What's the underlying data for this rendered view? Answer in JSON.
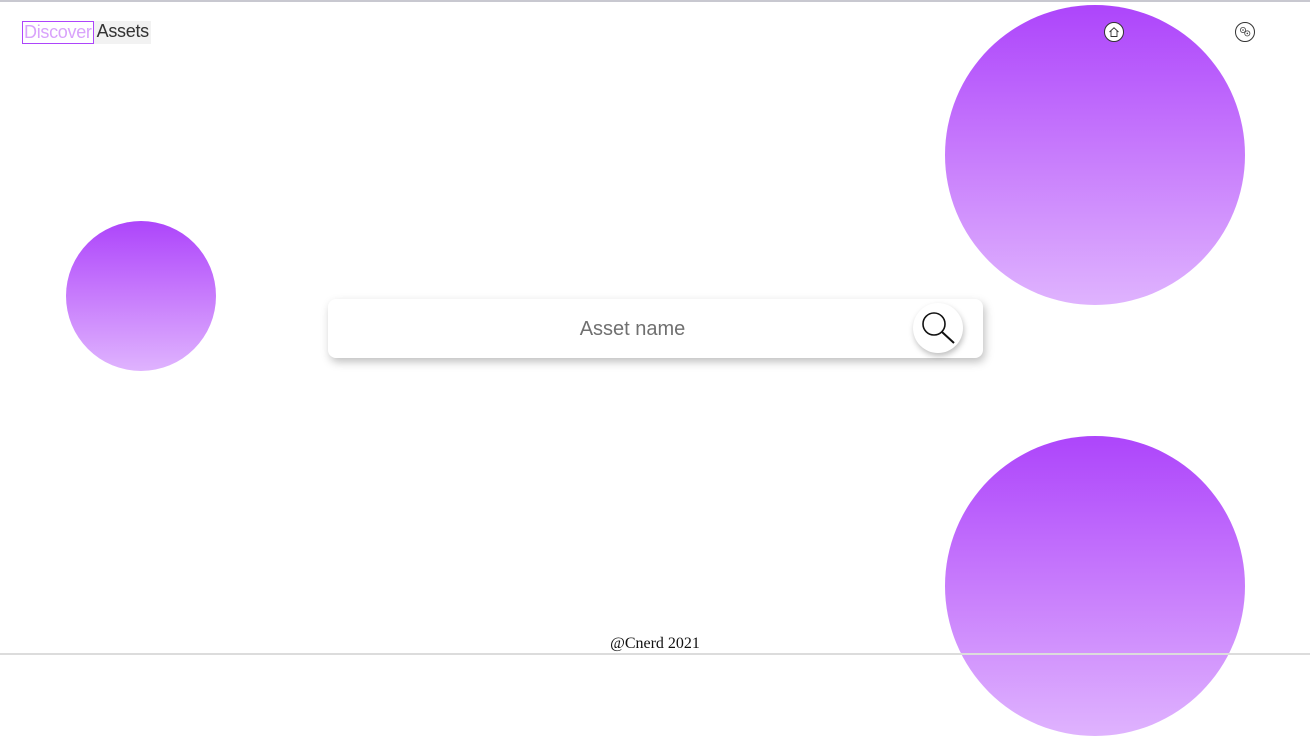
{
  "header": {
    "logo": {
      "part1": "Discover",
      "part2": "Assets"
    },
    "nav": [
      {
        "icon": "home-icon"
      },
      {
        "icon": "assets-icon"
      }
    ]
  },
  "search": {
    "placeholder": "Asset name",
    "value": "",
    "button_icon": "search-icon"
  },
  "footer": {
    "text": "@Cnerd 2021"
  },
  "colors": {
    "accent": "#ad45fb",
    "accent_light": "#dfb3fe",
    "logo_discover_text": "#d9a3fb",
    "background": "#ffffff"
  }
}
